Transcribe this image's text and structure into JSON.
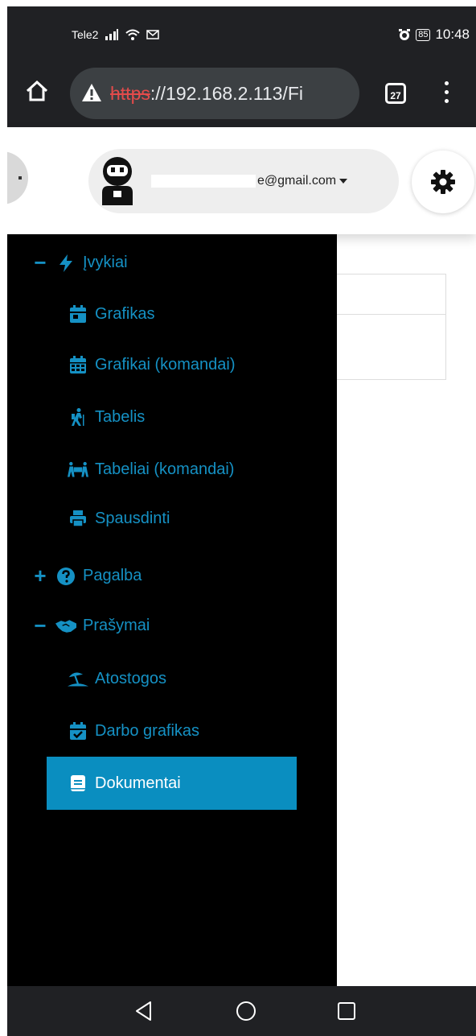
{
  "status_bar": {
    "carrier": "Tele2",
    "battery": "85",
    "time": "10:48"
  },
  "browser": {
    "url_scheme": "https",
    "url_rest": "://192.168.2.113/Fi",
    "tab_count": "27"
  },
  "header": {
    "email_visible": "e@gmail.com"
  },
  "sidebar": {
    "groups": [
      {
        "label": "Įvykiai",
        "toggle": "−",
        "icon": "bolt-icon"
      },
      {
        "label": "Pagalba",
        "toggle": "+",
        "icon": "question-circle-icon"
      },
      {
        "label": "Prašymai",
        "toggle": "−",
        "icon": "handshake-icon"
      }
    ],
    "items": [
      {
        "label": "Grafikas",
        "icon": "calendar-day-icon"
      },
      {
        "label": "Grafikai (komandai)",
        "icon": "calendar-grid-icon"
      },
      {
        "label": "Tabelis",
        "icon": "hiking-person-icon"
      },
      {
        "label": "Tabeliai (komandai)",
        "icon": "people-carry-icon"
      },
      {
        "label": "Spausdinti",
        "icon": "print-icon"
      },
      {
        "label": "Atostogos",
        "icon": "umbrella-beach-icon"
      },
      {
        "label": "Darbo grafikas",
        "icon": "calendar-check-icon"
      },
      {
        "label": "Dokumentai",
        "icon": "book-icon",
        "active": true
      }
    ]
  },
  "colors": {
    "sidebar_bg": "#000000",
    "menu_text": "#1591c4",
    "active_bg": "#0a8ec0",
    "chrome_bg": "#202124"
  }
}
